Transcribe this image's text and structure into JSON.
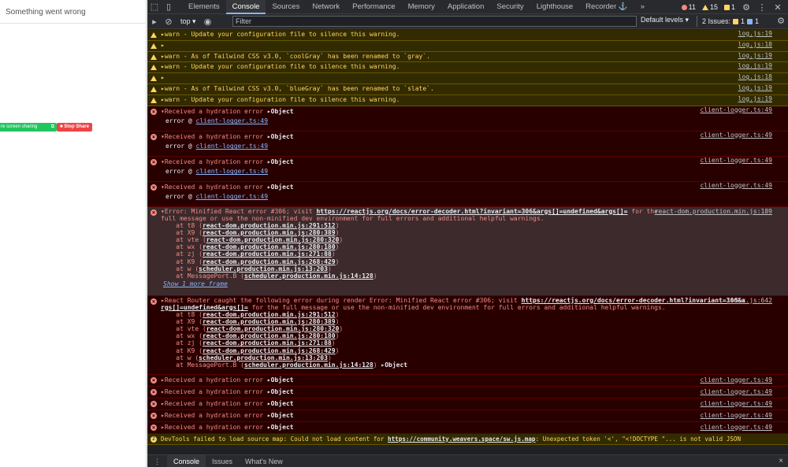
{
  "page": {
    "error_title": "Something went wrong",
    "share_label": "re screen sharing",
    "stop_share_label": "Stop Share"
  },
  "devtools": {
    "tabs": [
      "Elements",
      "Console",
      "Sources",
      "Network",
      "Performance",
      "Memory",
      "Application",
      "Security",
      "Lighthouse",
      "Recorder ⚓"
    ],
    "more_tabs": "»",
    "error_count": "11",
    "warning_count": "15",
    "issue_count": "1",
    "context": "top ▾",
    "filter_placeholder": "Filter",
    "levels": "Default levels ▾",
    "issues_label": "2 Issues:",
    "issues_warn": "1",
    "issues_info": "1",
    "prompt": "›",
    "drawer_tabs": [
      "Console",
      "Issues",
      "What's New"
    ],
    "drawer_close": "×"
  },
  "messages": [
    {
      "type": "warn",
      "text": "▸warn - Update your configuration file to silence this warning.",
      "src": "log.js:19"
    },
    {
      "type": "warn",
      "text": "▸",
      "src": "log.js:18"
    },
    {
      "type": "warn",
      "text": "▸warn - As of Tailwind CSS v3.0, `coolGray` has been renamed to `gray`.",
      "src": "log.js:19"
    },
    {
      "type": "warn",
      "text": "▸warn - Update your configuration file to silence this warning.",
      "src": "log.js:19"
    },
    {
      "type": "warn",
      "text": "▸",
      "src": "log.js:18"
    },
    {
      "type": "warn",
      "text": "▸warn - As of Tailwind CSS v3.0, `blueGray` has been renamed to `slate`.",
      "src": "log.js:19"
    },
    {
      "type": "warn",
      "text": "▸warn - Update your configuration file to silence this warning.",
      "src": "log.js:19"
    }
  ],
  "hydration_expanded": [
    {
      "text": "▾Received a hydration error ",
      "obj": "▸Object",
      "sub_prefix": "error @ ",
      "sub_link": "client-logger.ts:49",
      "src": "client-logger.ts:49"
    },
    {
      "text": "▾Received a hydration error ",
      "obj": "▸Object",
      "sub_prefix": "error @ ",
      "sub_link": "client-logger.ts:49",
      "src": "client-logger.ts:49"
    },
    {
      "text": "▾Received a hydration error ",
      "obj": "▸Object",
      "sub_prefix": "error @ ",
      "sub_link": "client-logger.ts:49",
      "src": "client-logger.ts:49"
    },
    {
      "text": "▾Received a hydration error ",
      "obj": "▸Object",
      "sub_prefix": "error @ ",
      "sub_link": "client-logger.ts:49",
      "src": "client-logger.ts:49"
    }
  ],
  "react_error": {
    "line1_prefix": "▾Error: Minified React error #306; visit ",
    "line1_link": "https://reactjs.org/docs/error-decoder.html?invariant=306&args[]=undefined&args[]=",
    "line1_suffix": " for the",
    "line2": "full message or use the non-minified dev environment for full errors and additional helpful warnings.",
    "src": "react-dom.production.min.js:189",
    "stack": [
      {
        "at": "    at t8 (",
        "loc": "react-dom.production.min.js:291:512",
        "end": ")"
      },
      {
        "at": "    at X9 (",
        "loc": "react-dom.production.min.js:280:389",
        "end": ")"
      },
      {
        "at": "    at vte (",
        "loc": "react-dom.production.min.js:280:320",
        "end": ")"
      },
      {
        "at": "    at wx (",
        "loc": "react-dom.production.min.js:280:180",
        "end": ")"
      },
      {
        "at": "    at zj (",
        "loc": "react-dom.production.min.js:271:88",
        "end": ")"
      },
      {
        "at": "    at K9 (",
        "loc": "react-dom.production.min.js:268:429",
        "end": ")"
      },
      {
        "at": "    at w (",
        "loc": "scheduler.production.min.js:13:203",
        "end": ")"
      },
      {
        "at": "    at MessagePort.B (",
        "loc": "scheduler.production.min.js:14:128",
        "end": ")"
      }
    ],
    "show_more": "Show 1 more frame"
  },
  "router_error": {
    "line1_prefix": "▸React Router caught the following error during render Error: Minified React error #306; visit ",
    "line1_link": "https://reactjs.org/docs/error-decoder.html?invariant=306&a",
    "line2_link": "rgs[]=undefined&args[]=",
    "line2_suffix": " for the full message or use the non-minified dev environment for full errors and additional helpful warnings.",
    "src": "index.js:642",
    "stack": [
      {
        "at": "    at t8 (",
        "loc": "react-dom.production.min.js:291:512",
        "end": ")"
      },
      {
        "at": "    at X9 (",
        "loc": "react-dom.production.min.js:280:389",
        "end": ")"
      },
      {
        "at": "    at vte (",
        "loc": "react-dom.production.min.js:280:320",
        "end": ")"
      },
      {
        "at": "    at wx (",
        "loc": "react-dom.production.min.js:280:180",
        "end": ")"
      },
      {
        "at": "    at zj (",
        "loc": "react-dom.production.min.js:271:88",
        "end": ")"
      },
      {
        "at": "    at K9 (",
        "loc": "react-dom.production.min.js:268:429",
        "end": ")"
      },
      {
        "at": "    at w (",
        "loc": "scheduler.production.min.js:13:203",
        "end": ")"
      },
      {
        "at": "    at MessagePort.B (",
        "loc": "scheduler.production.min.js:14:128",
        "end": ") "
      }
    ],
    "obj": "▸Object"
  },
  "hydration_collapsed": [
    {
      "text": "▸Received a hydration error ",
      "obj": "▸Object",
      "src": "client-logger.ts:49"
    },
    {
      "text": "▸Received a hydration error ",
      "obj": "▸Object",
      "src": "client-logger.ts:49"
    },
    {
      "text": "▸Received a hydration error ",
      "obj": "▸Object",
      "src": "client-logger.ts:49"
    },
    {
      "text": "▸Received a hydration error ",
      "obj": "▸Object",
      "src": "client-logger.ts:49"
    },
    {
      "text": "▸Received a hydration error ",
      "obj": "▸Object",
      "src": "client-logger.ts:49"
    }
  ],
  "sourcemap_warning": {
    "badge": "2",
    "prefix": "DevTools failed to load source map: Could not load content for ",
    "link": "https://community.weavers.space/sw.js.map",
    "suffix": ": Unexpected token '<', \"<!DOCTYPE \"... is not valid JSON"
  }
}
